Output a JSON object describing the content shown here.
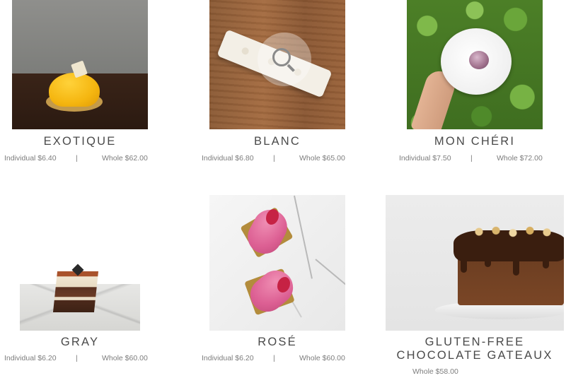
{
  "products": [
    {
      "title": "EXOTIQUE",
      "individual": "Individual $6.40",
      "separator": "|",
      "whole": "Whole $62.00"
    },
    {
      "title": "BLANC",
      "individual": "Individual $6.80",
      "separator": "|",
      "whole": "Whole $65.00"
    },
    {
      "title": "MON CHÉRI",
      "individual": "Individual $7.50",
      "separator": "|",
      "whole": "Whole $72.00"
    },
    {
      "title": "GRAY",
      "individual": "Individual $6.20",
      "separator": "|",
      "whole": "Whole $60.00"
    },
    {
      "title": "ROSÉ",
      "individual": "Individual $6.20",
      "separator": "|",
      "whole": "Whole $60.00"
    },
    {
      "title_line1": "GLUTEN-FREE",
      "title_line2": "CHOCOLATE GATEAUX",
      "whole": "Whole $58.00"
    }
  ],
  "zoom_overlay": {
    "icon": "magnifier-icon"
  },
  "colors": {
    "text_title": "#4a4a4a",
    "text_price": "#7d7d7d",
    "background": "#ffffff"
  }
}
